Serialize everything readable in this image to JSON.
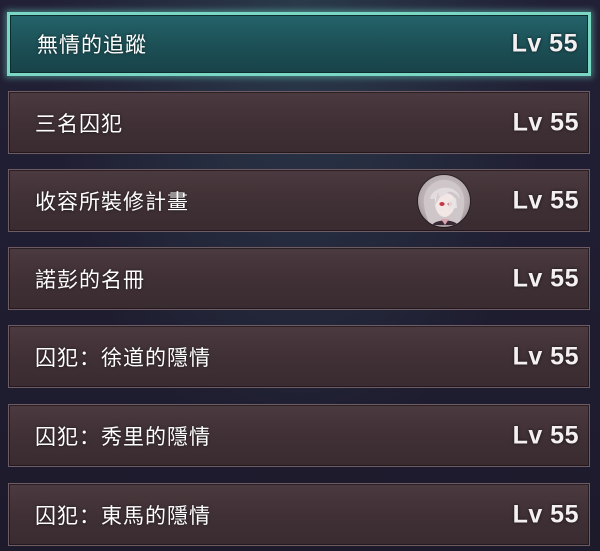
{
  "quests": [
    {
      "title": "無情的追蹤",
      "level": "Lv 55",
      "selected": true
    },
    {
      "title": "三名囚犯",
      "level": "Lv 55"
    },
    {
      "title": "收容所裝修計畫",
      "level": "Lv 55",
      "icon": "character-portrait-icon"
    },
    {
      "title": "諾彭的名冊",
      "level": "Lv 55"
    },
    {
      "title": "囚犯：徐道的隱情",
      "level": "Lv 55"
    },
    {
      "title": "囚犯：秀里的隱情",
      "level": "Lv 55"
    },
    {
      "title": "囚犯：東馬的隱情",
      "level": "Lv 55"
    }
  ],
  "colors": {
    "selected_accent": "#7ad7c4",
    "selected_fill": "#1c5157",
    "item_fill": "#3f3035",
    "background": "#1f1c2e"
  }
}
